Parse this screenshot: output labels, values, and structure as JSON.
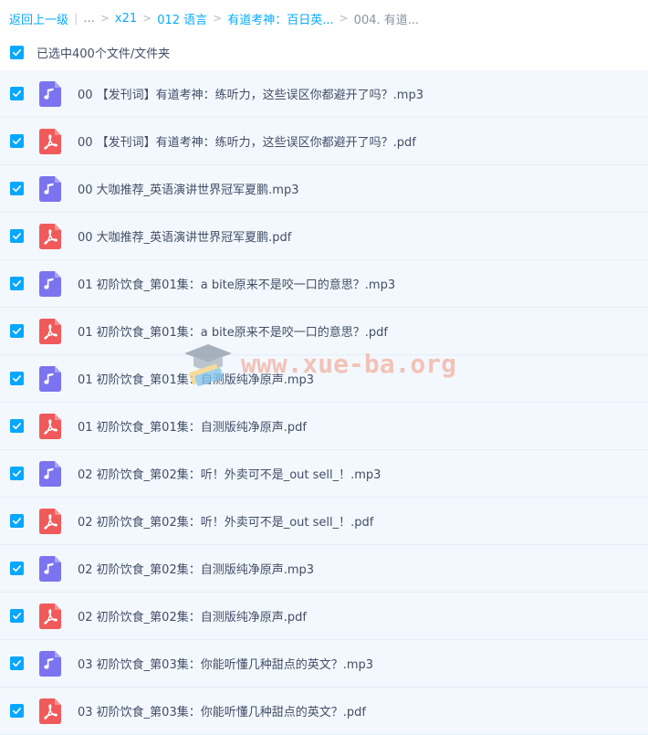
{
  "breadcrumb": {
    "back": "返回上一级",
    "ellipsis": "...",
    "items": [
      "x21",
      "012 语言",
      "有道考神：百日英..."
    ],
    "current": "004. 有道..."
  },
  "selection": {
    "label": "已选中400个文件/文件夹"
  },
  "colors": {
    "accent": "#06a7ff",
    "audio_icon": "#7b73f0",
    "pdf_icon": "#f05a5a",
    "row_bg": "#f3f8fe"
  },
  "files": [
    {
      "name": "00 【发刊词】有道考神：练听力，这些误区你都避开了吗？.mp3",
      "type": "audio",
      "icon": "music-note-icon"
    },
    {
      "name": "00 【发刊词】有道考神：练听力，这些误区你都避开了吗？.pdf",
      "type": "pdf",
      "icon": "pdf-icon"
    },
    {
      "name": "00 大咖推荐_英语演讲世界冠军夏鹏.mp3",
      "type": "audio",
      "icon": "music-note-icon"
    },
    {
      "name": "00 大咖推荐_英语演讲世界冠军夏鹏.pdf",
      "type": "pdf",
      "icon": "pdf-icon"
    },
    {
      "name": "01 初阶饮食_第01集：a bite原来不是咬一口的意思？.mp3",
      "type": "audio",
      "icon": "music-note-icon"
    },
    {
      "name": "01 初阶饮食_第01集：a bite原来不是咬一口的意思？.pdf",
      "type": "pdf",
      "icon": "pdf-icon"
    },
    {
      "name": "01 初阶饮食_第01集：自测版纯净原声.mp3",
      "type": "audio",
      "icon": "music-note-icon"
    },
    {
      "name": "01 初阶饮食_第01集：自测版纯净原声.pdf",
      "type": "pdf",
      "icon": "pdf-icon"
    },
    {
      "name": "02 初阶饮食_第02集：听！外卖可不是_out sell_！.mp3",
      "type": "audio",
      "icon": "music-note-icon"
    },
    {
      "name": "02 初阶饮食_第02集：听！外卖可不是_out sell_！.pdf",
      "type": "pdf",
      "icon": "pdf-icon"
    },
    {
      "name": "02 初阶饮食_第02集：自测版纯净原声.mp3",
      "type": "audio",
      "icon": "music-note-icon"
    },
    {
      "name": "02 初阶饮食_第02集：自测版纯净原声.pdf",
      "type": "pdf",
      "icon": "pdf-icon"
    },
    {
      "name": "03 初阶饮食_第03集：你能听懂几种甜点的英文？.mp3",
      "type": "audio",
      "icon": "music-note-icon"
    },
    {
      "name": "03 初阶饮食_第03集：你能听懂几种甜点的英文？.pdf",
      "type": "pdf",
      "icon": "pdf-icon"
    }
  ],
  "watermark": {
    "text": "www.xue-ba.org"
  }
}
